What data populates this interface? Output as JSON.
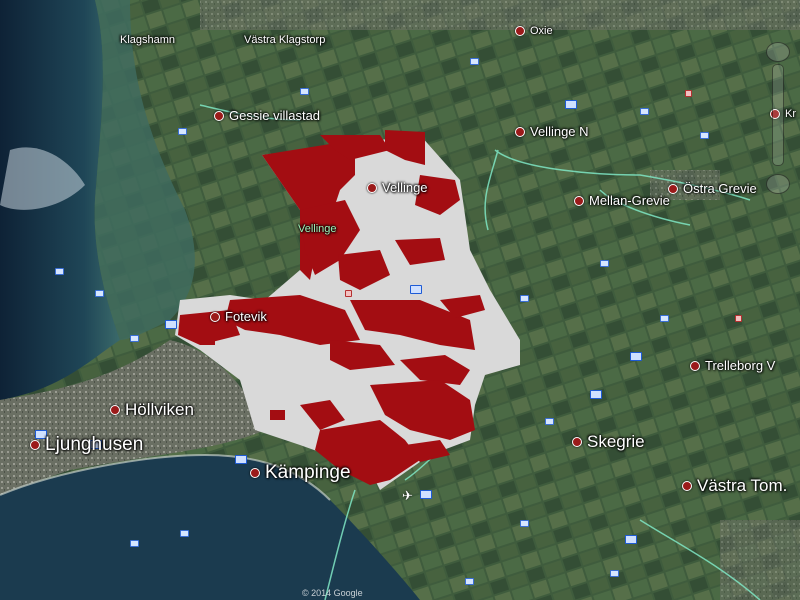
{
  "places": {
    "klagshamn": "Klagshamn",
    "vastra_klagstorp": "Västra Klagstorp",
    "oxie": "Oxie",
    "gessie_villastad": "Gessie villastad",
    "vellinge_n": "Vellinge N",
    "vellinge": "Vellinge",
    "vellinge_area": "Vellinge",
    "mellan_grevie": "Mellan-Grevie",
    "ostra_grevie": "Östra Grevie",
    "fotevik": "Fotevik",
    "hollviken": "Höllviken",
    "ljunghusen": "Ljunghusen",
    "kampinge": "Kämpinge",
    "skegrie": "Skegrie",
    "trelleborg_v": "Trelleborg V",
    "vastra_tom": "Västra Tom.",
    "kr": "Kr"
  },
  "credit": "© 2014 Google",
  "colors": {
    "overlay_red": "#a30d12",
    "overlay_grey": "#d9d9d9",
    "boundary": "#7fe6c4",
    "sea": "#1d3d4e",
    "land": "#3e5a3c"
  },
  "icons": [
    "place-marker-icon",
    "poi-icon",
    "house-icon",
    "photo-icon",
    "airport-icon",
    "navigation-control-icon"
  ]
}
